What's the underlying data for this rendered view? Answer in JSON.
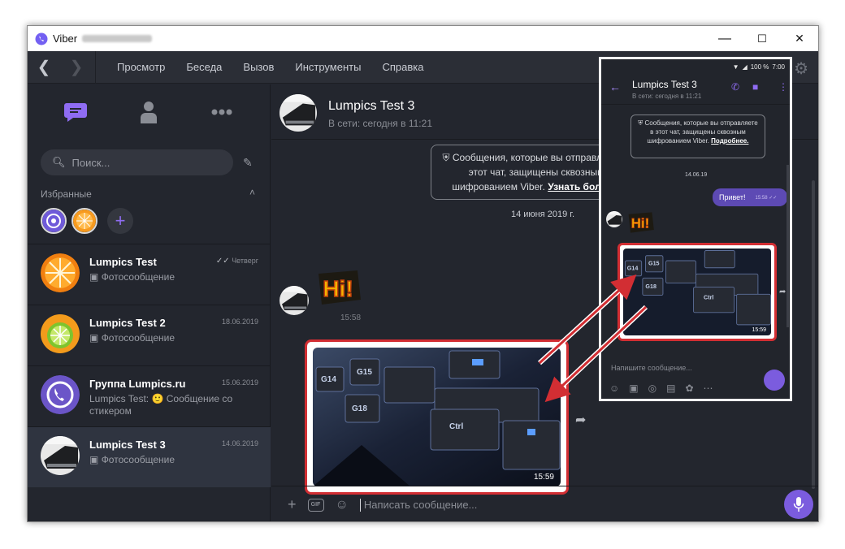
{
  "window": {
    "app_title": "Viber",
    "controls": {
      "minimize": "—",
      "maximize": "☐",
      "close": "✕"
    }
  },
  "menu": {
    "items": [
      "Просмотр",
      "Беседа",
      "Вызов",
      "Инструменты",
      "Справка"
    ]
  },
  "search": {
    "placeholder": "Поиск..."
  },
  "favorites": {
    "label": "Избранные"
  },
  "chats": [
    {
      "name": "Lumpics Test",
      "time": "Четверг",
      "preview": "Фотосообщение",
      "read": true
    },
    {
      "name": "Lumpics Test 2",
      "time": "18.06.2019",
      "preview": "Фотосообщение"
    },
    {
      "name": "Группа Lumpics.ru",
      "time": "15.06.2019",
      "preview": "Lumpics Test: 🙂 Сообщение со стикером"
    },
    {
      "name": "Lumpics Test 3",
      "time": "14.06.2019",
      "preview": "Фотосообщение",
      "active": true
    }
  ],
  "conversation": {
    "name": "Lumpics Test 3",
    "status": "В сети: сегодня в 11:21",
    "notice_text": "Сообщения, которые вы отправляете в этот чат, защищены сквозным шифрованием Viber.",
    "notice_link": "Узнать больше",
    "date": "14 июня 2019 г.",
    "sticker_text": "Hi!",
    "sticker_time": "15:58",
    "photo_time": "15:59",
    "composer_placeholder": "Написать сообщение..."
  },
  "phone": {
    "battery": "100 %",
    "clock": "7:00",
    "name": "Lumpics Test 3",
    "status": "В сети: сегодня в 11:21",
    "notice_text": "Сообщения, которые вы отправляете в этот чат, защищены сквозным шифрованием Viber.",
    "notice_link": "Подробнее.",
    "date": "14.06.19",
    "message_text": "Привет!",
    "message_time": "15:58",
    "sticker_text": "Hi!",
    "photo_time": "15:59",
    "composer_placeholder": "Напишите сообщение..."
  },
  "colors": {
    "accent": "#7b5cde",
    "highlight": "#d22e33",
    "bg": "#23262e"
  }
}
